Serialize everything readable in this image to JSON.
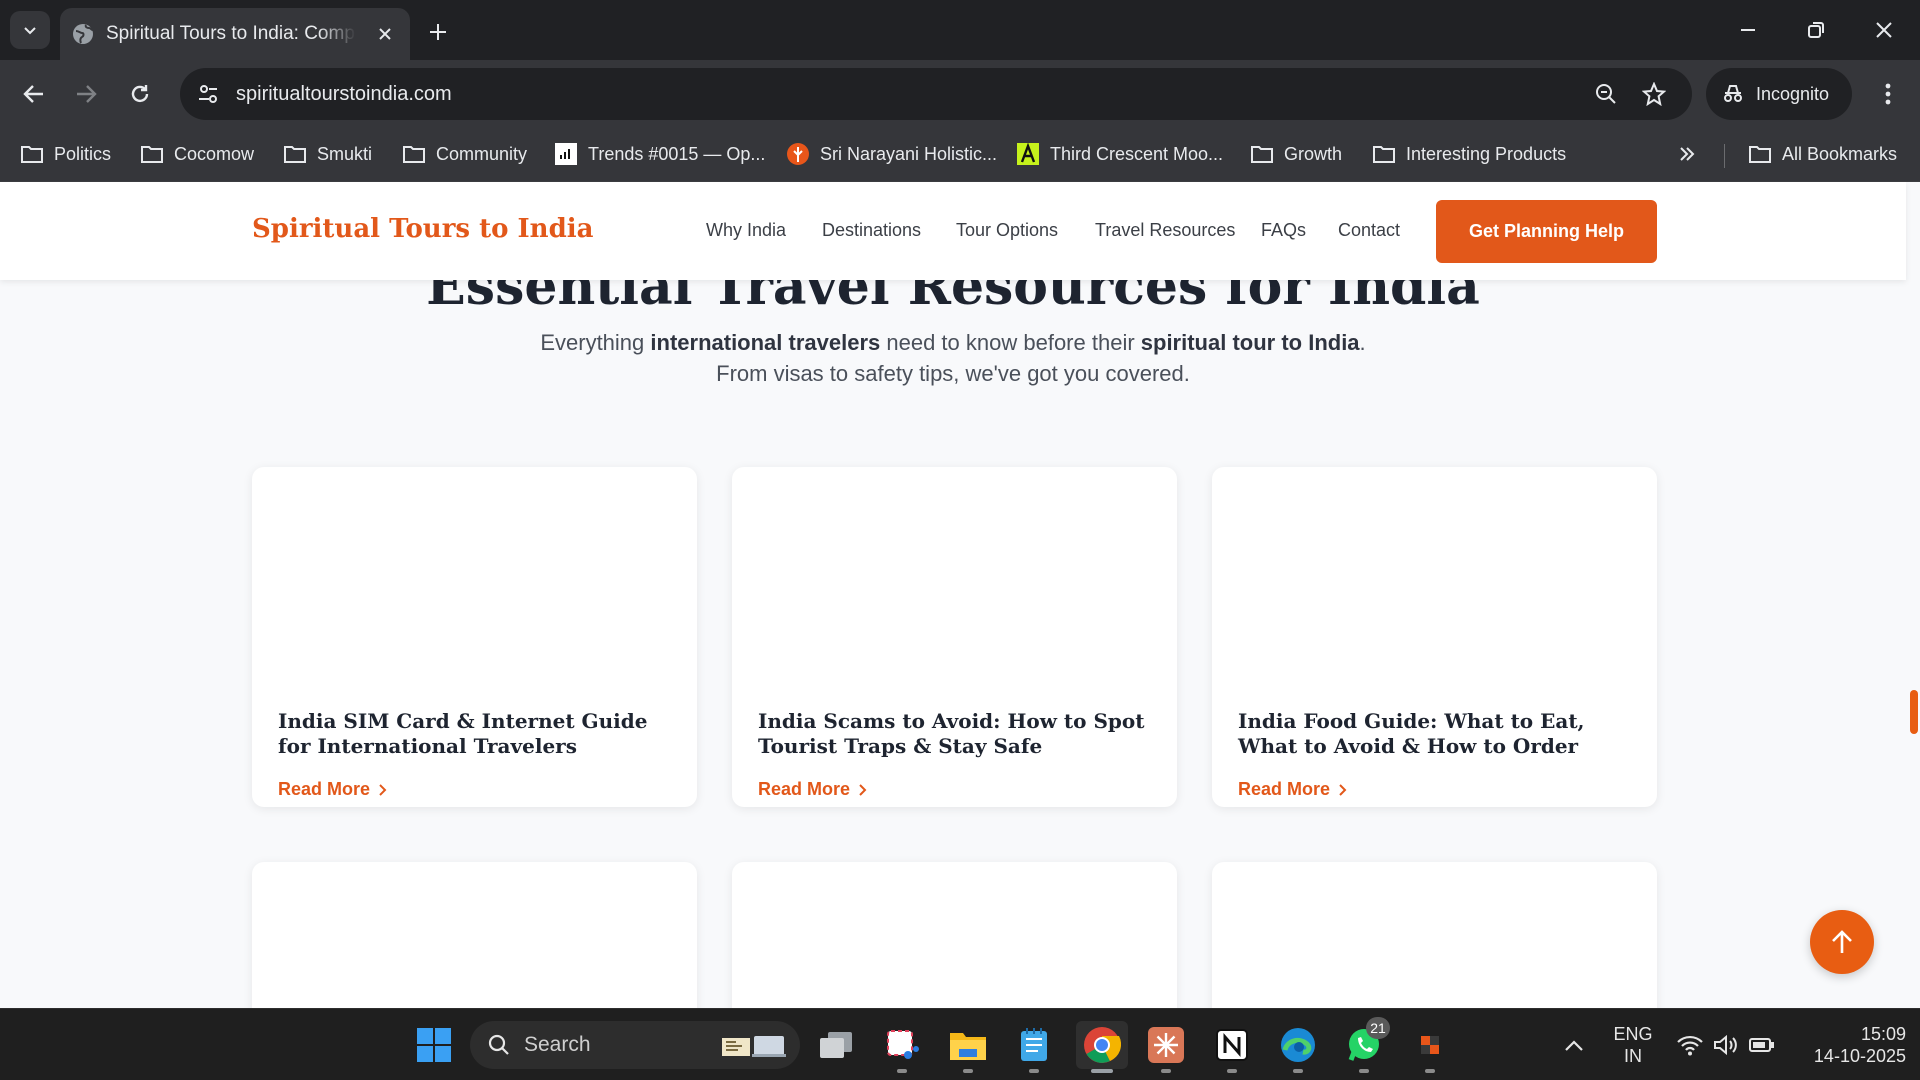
{
  "browser": {
    "tab_title": "Spiritual Tours to India: Complete",
    "url": "spiritualtourstoindia.com",
    "profile_label": "Incognito",
    "bookmarks": [
      {
        "label": "Politics",
        "icon": "folder-icon"
      },
      {
        "label": "Cocomow",
        "icon": "folder-icon"
      },
      {
        "label": "Smukti",
        "icon": "folder-icon"
      },
      {
        "label": "Community",
        "icon": "folder-icon"
      },
      {
        "label": "Trends #0015 — Op...",
        "icon": "trends-favicon"
      },
      {
        "label": "Sri Narayani Holistic...",
        "icon": "narayani-favicon"
      },
      {
        "label": "Third Crescent Moo...",
        "icon": "crescent-favicon"
      },
      {
        "label": "Growth",
        "icon": "folder-icon"
      },
      {
        "label": "Interesting Products",
        "icon": "folder-icon"
      }
    ],
    "all_bookmarks_label": "All Bookmarks"
  },
  "site": {
    "logo": "Spiritual Tours to India",
    "nav": [
      "Why India",
      "Destinations",
      "Tour Options",
      "Travel Resources",
      "FAQs",
      "Contact"
    ],
    "cta": "Get Planning Help",
    "brand_color": "#e2581a"
  },
  "section": {
    "heading": "Essential Travel Resources for India",
    "subtitle_line1_a": "Everything ",
    "subtitle_line1_b": "international travelers",
    "subtitle_line1_c": " need to know before their ",
    "subtitle_line1_d": "spiritual tour to India",
    "subtitle_line1_e": ".",
    "subtitle_line2": "From visas to safety tips, we've got you covered."
  },
  "cards": [
    {
      "title": "India SIM Card & Internet Guide for International Travelers",
      "link": "Read More"
    },
    {
      "title": "India Scams to Avoid: How to Spot Tourist Traps & Stay Safe",
      "link": "Read More"
    },
    {
      "title": "India Food Guide: What to Eat, What to Avoid & How to Order",
      "link": "Read More"
    }
  ],
  "taskbar": {
    "search_label": "Search",
    "whatsapp_badge": "21",
    "lang_line1": "ENG",
    "lang_line2": "IN",
    "time": "15:09",
    "date": "14-10-2025"
  }
}
